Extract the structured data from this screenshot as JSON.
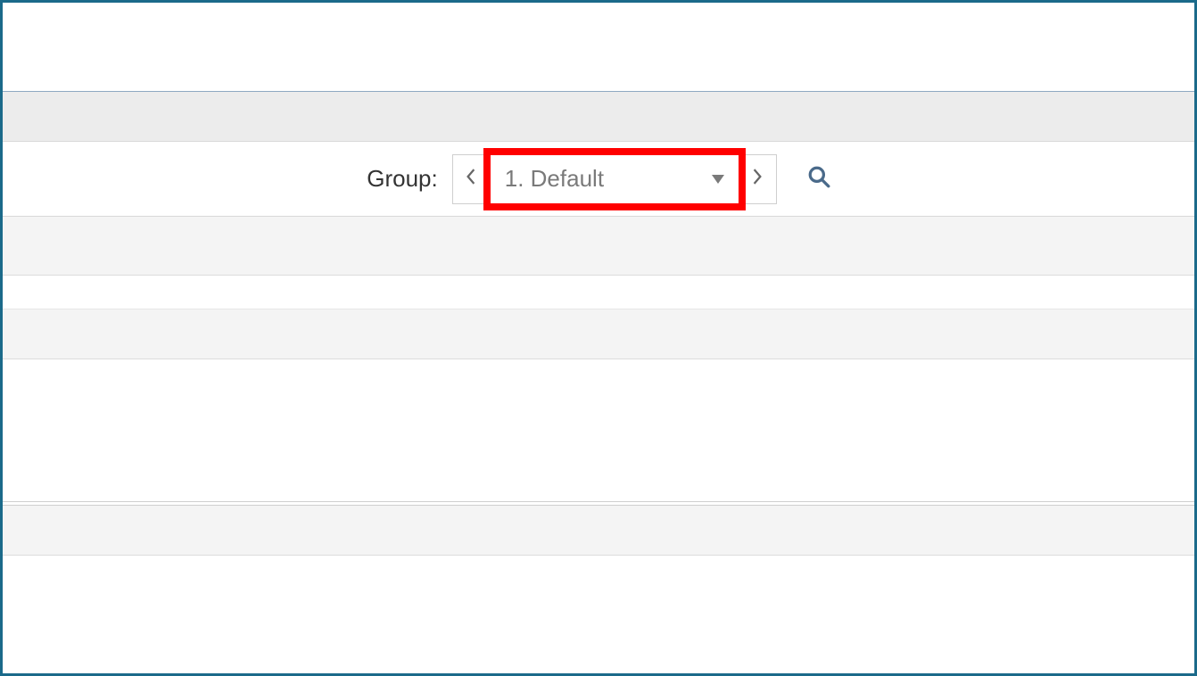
{
  "group": {
    "label": "Group:",
    "selected": "1. Default"
  },
  "highlight": {
    "color": "#ff0000"
  }
}
